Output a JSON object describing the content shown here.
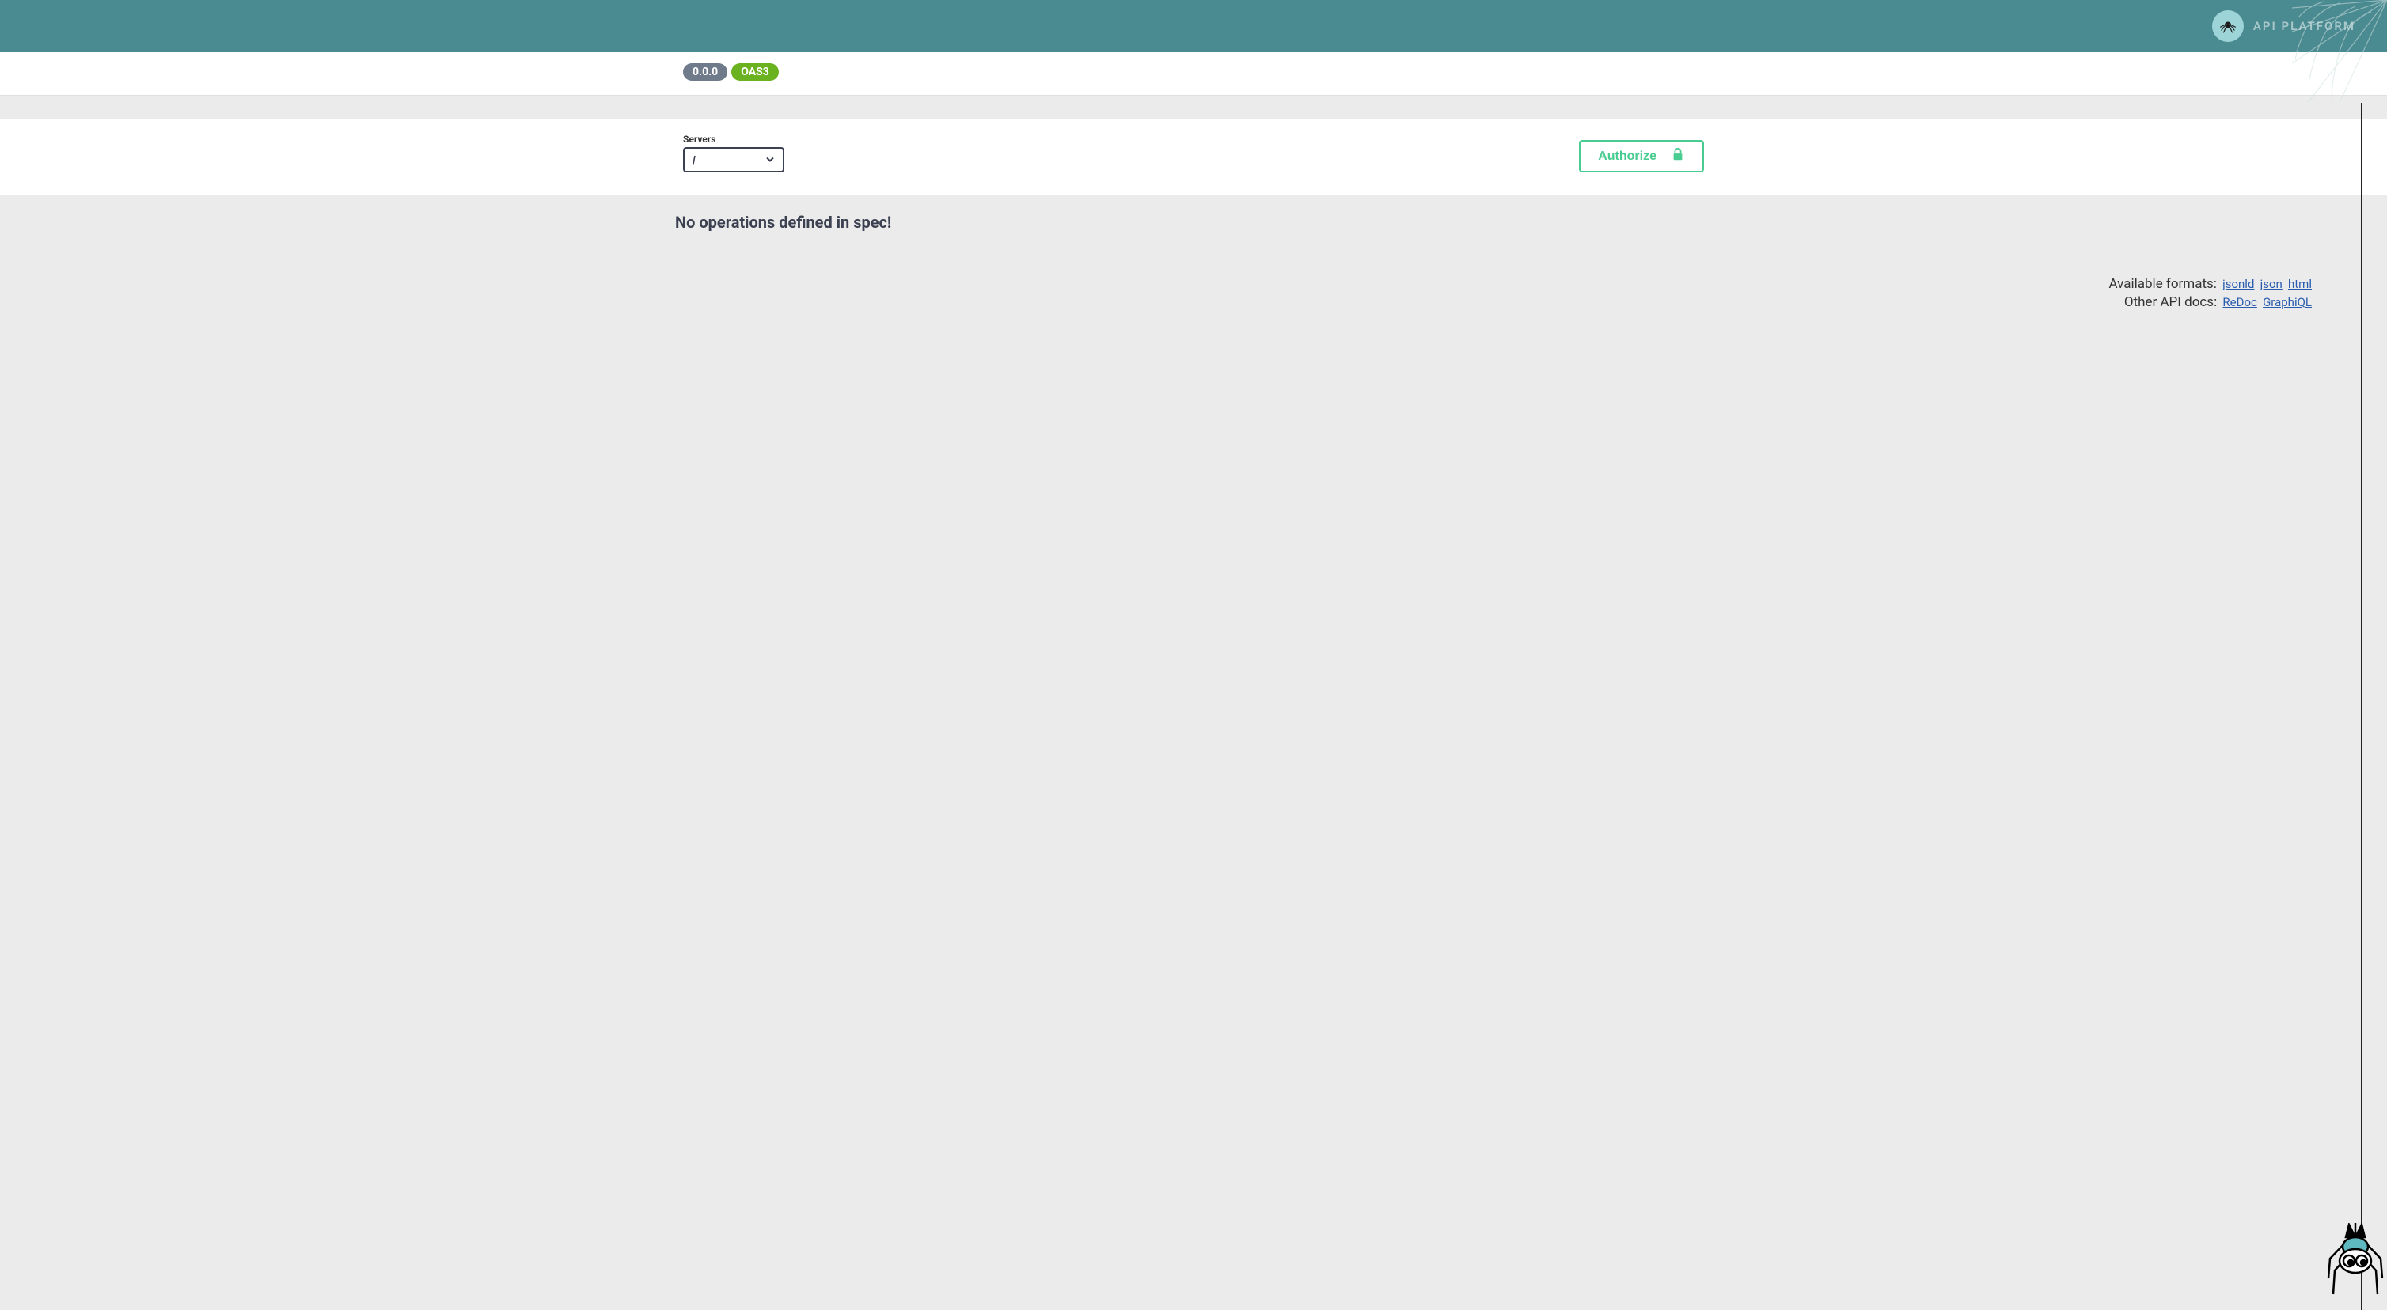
{
  "header": {
    "brand_text": "API Platform"
  },
  "info": {
    "version_badge": "0.0.0",
    "oas_badge": "OAS3"
  },
  "servers": {
    "label": "Servers",
    "selected": "/"
  },
  "authorize": {
    "label": "Authorize"
  },
  "main": {
    "no_operations_text": "No operations defined in spec!"
  },
  "formats": {
    "available_label": "Available formats:",
    "links": [
      "jsonld",
      "json",
      "html"
    ],
    "other_docs_label": "Other API docs:",
    "docs_links": [
      "ReDoc",
      "GraphiQL"
    ]
  }
}
